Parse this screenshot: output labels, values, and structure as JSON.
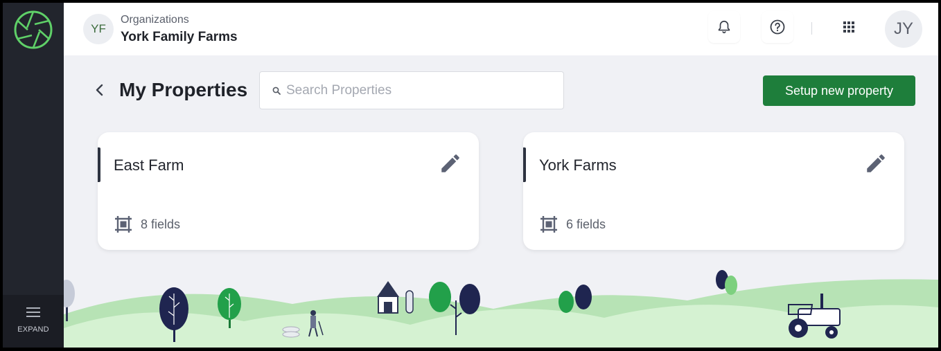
{
  "sidebar": {
    "expand_label": "EXPAND"
  },
  "org": {
    "initials": "YF",
    "kicker": "Organizations",
    "name": "York Family Farms"
  },
  "user": {
    "initials": "JY"
  },
  "page": {
    "title": "My Properties"
  },
  "search": {
    "placeholder": "Search Properties",
    "value": ""
  },
  "actions": {
    "setup_label": "Setup new property"
  },
  "properties": [
    {
      "name": "East Farm",
      "fields": "8 fields"
    },
    {
      "name": "York Farms",
      "fields": "6 fields"
    }
  ],
  "colors": {
    "sidebar": "#22252d",
    "accent_green": "#1e7e3b",
    "logo_green": "#5fd068",
    "background": "#f0f1f5"
  }
}
